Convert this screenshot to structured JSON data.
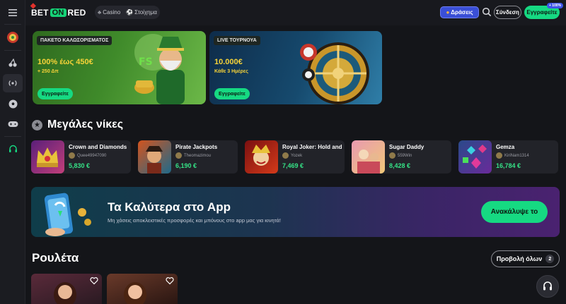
{
  "brand": {
    "logo_left": "BET",
    "logo_mid": "ON",
    "logo_right": "RED"
  },
  "header": {
    "nav": [
      {
        "label": "Casino",
        "icon": "cherries-icon"
      },
      {
        "label": "Στοίχημα",
        "icon": "soccer-ball-icon"
      }
    ],
    "promotions_label": "Δράσεις",
    "login_label": "Σύνδεση",
    "signup_label": "Εγγραφείτε",
    "signup_badge": "+ 100%"
  },
  "sidebar": {
    "items": [
      "menu-icon",
      "roulette-wheel-icon",
      "cherries-icon",
      "live-broadcast-icon",
      "soccer-ball-icon",
      "gamepad-icon",
      "headset-icon"
    ]
  },
  "banners": [
    {
      "tag": "ΠΑΚΕΤΟ ΚΑΛΩΣΟΡΙΣΜΑΤΟΣ",
      "title": "100% έως 450€",
      "subtitle": "+ 250 Δπ",
      "button": "Εγγραφείτε"
    },
    {
      "tag": "LIVE ΤΟΥΡΝΟΥΑ",
      "title": "10.000€",
      "subtitle": "Κάθε 3 Ημέρες",
      "button": "Εγγραφείτε"
    }
  ],
  "big_wins": {
    "title": "Μεγάλες νίκες",
    "items": [
      {
        "game": "Crown and Diamonds",
        "user": "Quee49947090",
        "amount": "5,830 €"
      },
      {
        "game": "Pirate Jackpots",
        "user": "Theomazimou",
        "amount": "6,190 €"
      },
      {
        "game": "Royal Joker: Hold and",
        "user": "Yozek",
        "amount": "7,469 €"
      },
      {
        "game": "Sugar Daddy",
        "user": "559Win",
        "amount": "8,428 €"
      },
      {
        "game": "Gemza",
        "user": "KiriNam1314",
        "amount": "16,784 €"
      }
    ]
  },
  "app_promo": {
    "title": "Τα Καλύτερα στο App",
    "subtitle": "Μη χάσεις αποκλειστικές προσφορές και μπόνους στο app μας για κινητά!",
    "button": "Ανακάλυψε το"
  },
  "roulette": {
    "title": "Ρουλέτα",
    "view_all": "Προβολή όλων",
    "count": "2"
  },
  "colors": {
    "accent": "#16d982",
    "bg": "#141519",
    "promo": "#3a4fd6",
    "win": "#35e286"
  }
}
